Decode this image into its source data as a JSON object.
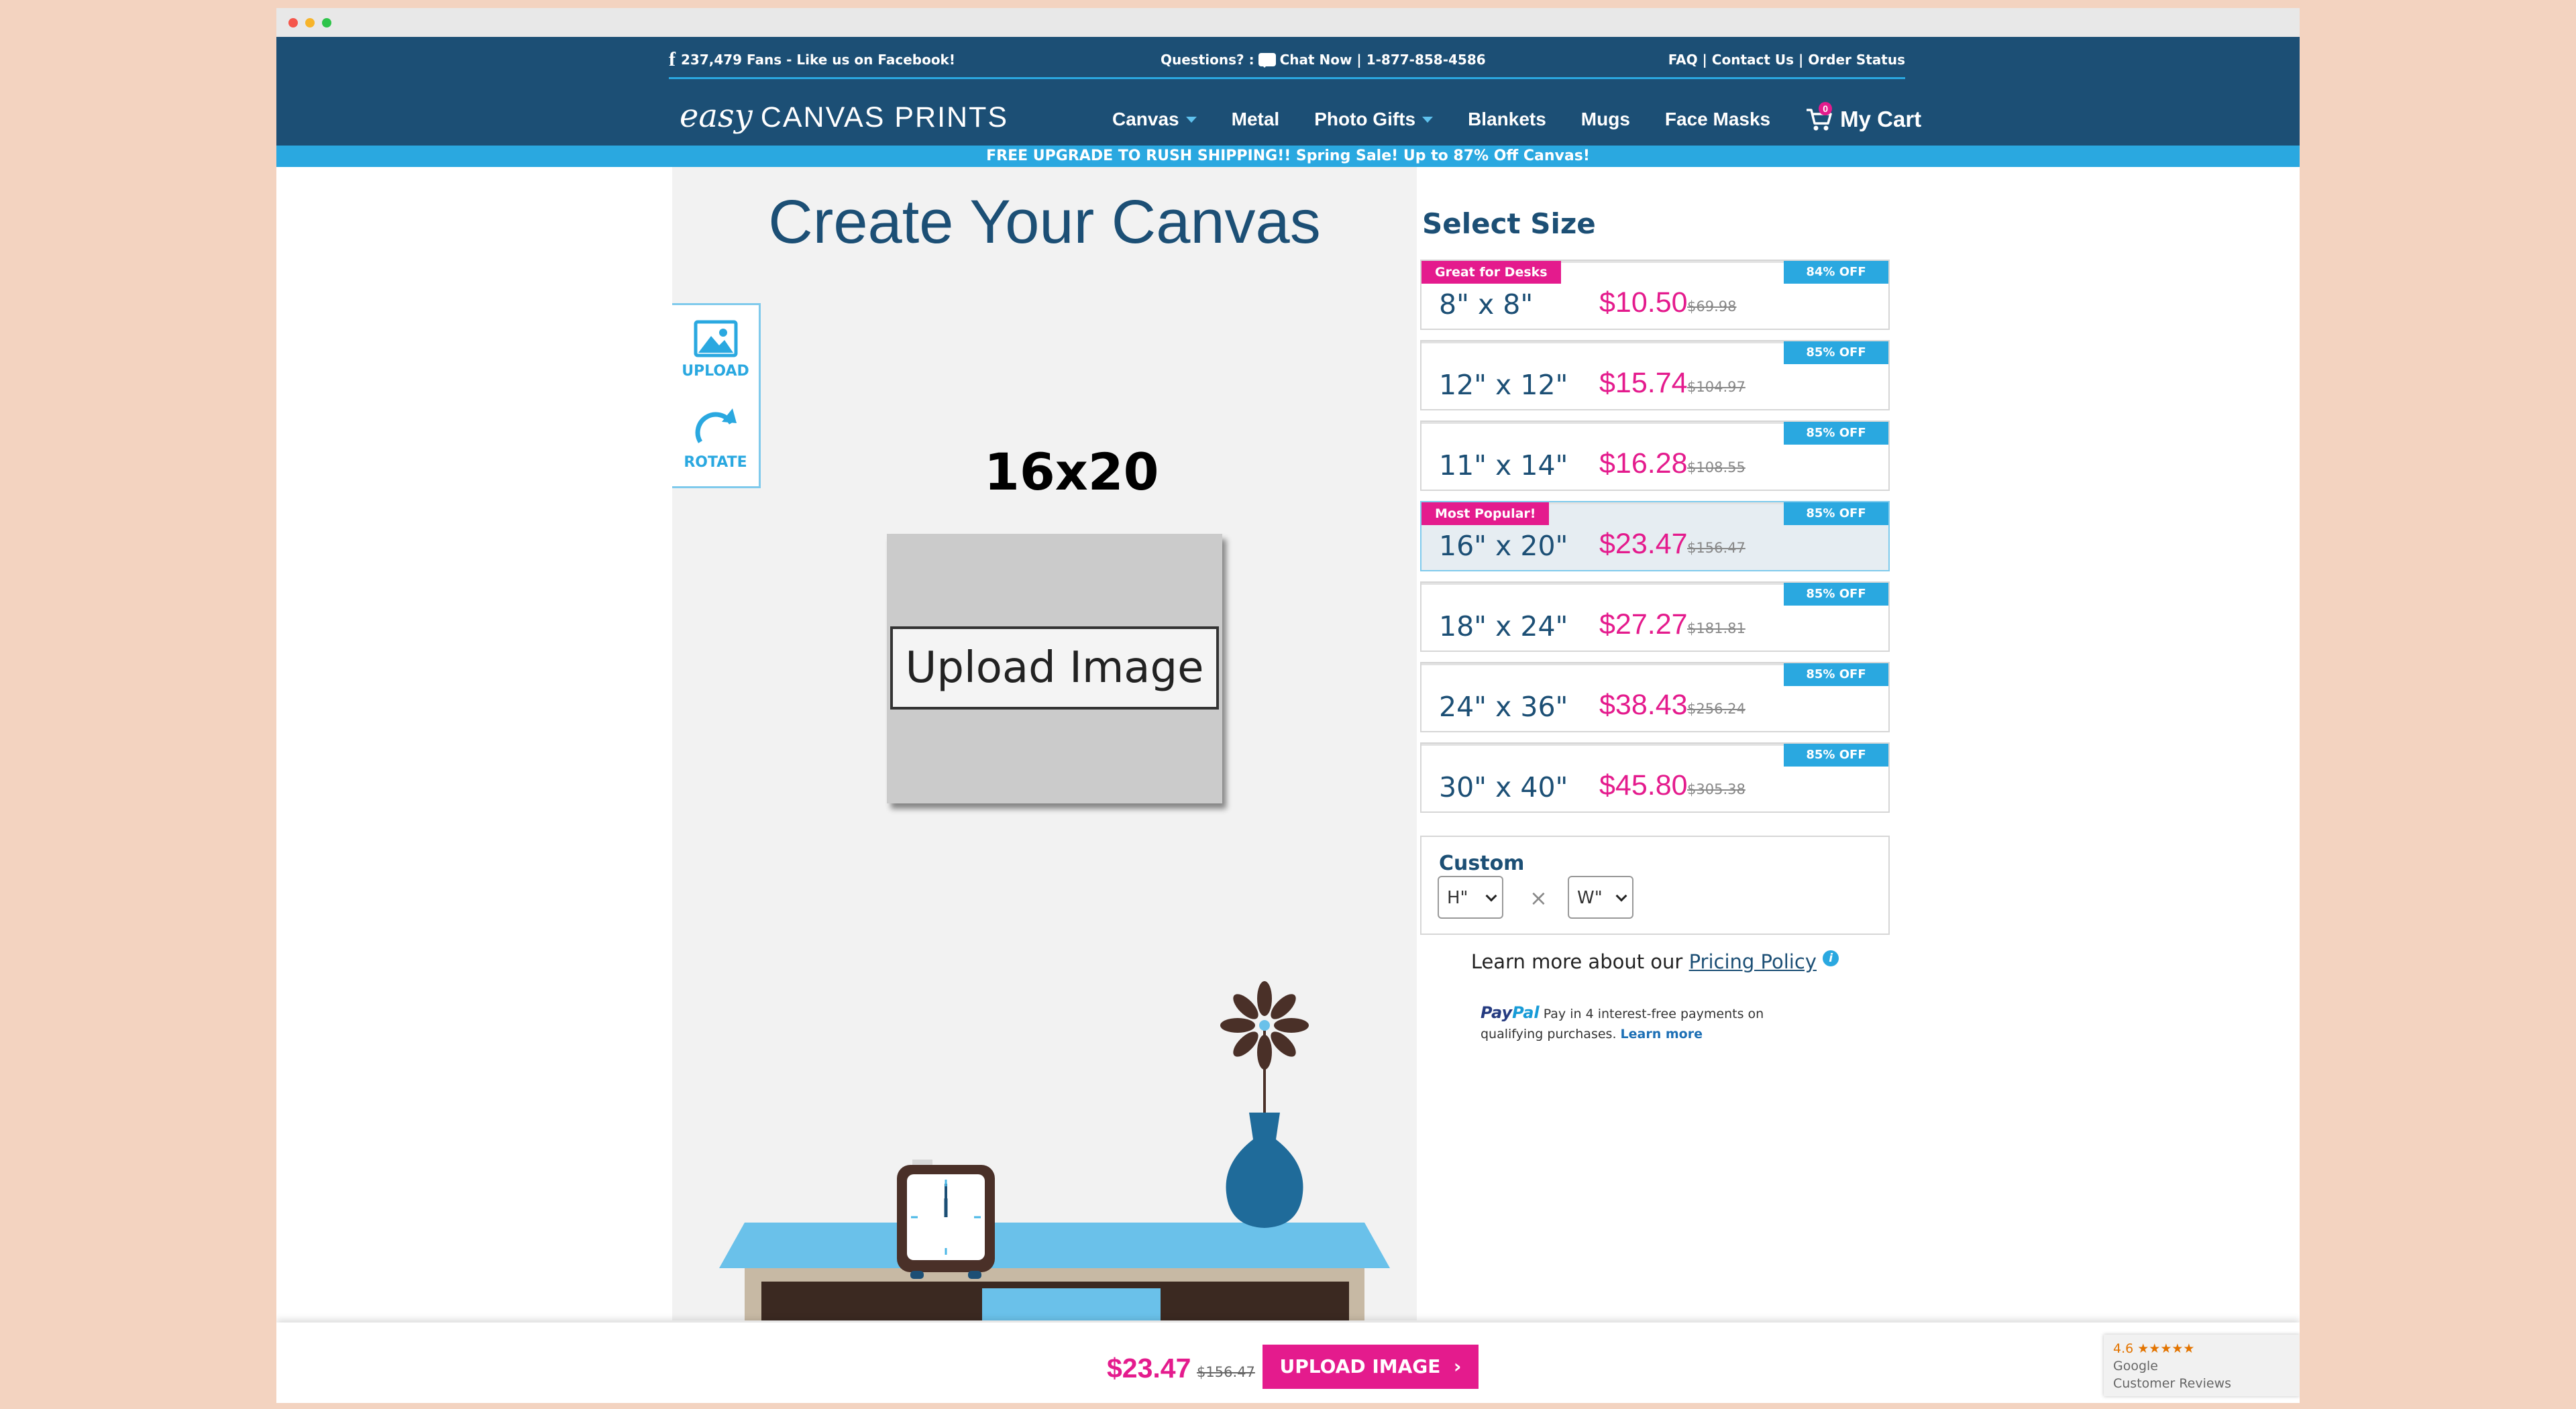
{
  "topbar": {
    "fans": "237,479 Fans - Like us on Facebook!",
    "questions": "Questions? :",
    "chat": "Chat Now | 1-877-858-4586",
    "links": "FAQ | Contact Us | Order Status"
  },
  "logo": {
    "easy": "easy",
    "brand": "CANVAS PRINTS"
  },
  "nav": {
    "items": [
      {
        "label": "Canvas",
        "dropdown": true
      },
      {
        "label": "Metal",
        "dropdown": false
      },
      {
        "label": "Photo Gifts",
        "dropdown": true
      },
      {
        "label": "Blankets",
        "dropdown": false
      },
      {
        "label": "Mugs",
        "dropdown": false
      },
      {
        "label": "Face Masks",
        "dropdown": false
      }
    ],
    "cart_label": "My Cart",
    "cart_count": "0"
  },
  "promo": "FREE UPGRADE TO RUSH SHIPPING!! Spring Sale! Up to 87% Off Canvas!",
  "editor": {
    "title": "Create Your Canvas",
    "upload_tool": "UPLOAD",
    "rotate_tool": "ROTATE",
    "size_label": "16x20",
    "upload_button": "Upload Image"
  },
  "sizes": {
    "title": "Select Size",
    "options": [
      {
        "dim": "8\" x 8\"",
        "price": "$10.50",
        "old": "$69.98",
        "off": "84% OFF",
        "tag": "Great for Desks"
      },
      {
        "dim": "12\" x 12\"",
        "price": "$15.74",
        "old": "$104.97",
        "off": "85% OFF",
        "tag": ""
      },
      {
        "dim": "11\" x 14\"",
        "price": "$16.28",
        "old": "$108.55",
        "off": "85% OFF",
        "tag": ""
      },
      {
        "dim": "16\" x 20\"",
        "price": "$23.47",
        "old": "$156.47",
        "off": "85% OFF",
        "tag": "Most Popular!"
      },
      {
        "dim": "18\" x 24\"",
        "price": "$27.27",
        "old": "$181.81",
        "off": "85% OFF",
        "tag": ""
      },
      {
        "dim": "24\" x 36\"",
        "price": "$38.43",
        "old": "$256.24",
        "off": "85% OFF",
        "tag": ""
      },
      {
        "dim": "30\" x 40\"",
        "price": "$45.80",
        "old": "$305.38",
        "off": "85% OFF",
        "tag": ""
      }
    ],
    "selected_index": 3,
    "custom": {
      "label": "Custom",
      "height": "H\"",
      "width": "W\"",
      "times": "×"
    },
    "learn_text": "Learn more about our",
    "learn_link": "Pricing Policy",
    "paypal_brand_1": "Pay",
    "paypal_brand_2": "Pal",
    "paypal_text": "Pay in 4 interest-free payments on qualifying purchases.",
    "paypal_link": "Learn more"
  },
  "bottom": {
    "price": "$23.47",
    "old": "$156.47",
    "button": "UPLOAD IMAGE"
  },
  "reviews": {
    "rating": "4.6 ★★★★★",
    "source": "Google",
    "label": "Customer Reviews"
  },
  "colors": {
    "navy": "#1c4f75",
    "accent_blue": "#2aa8e0",
    "magenta": "#e41b8d",
    "page_bg": "#f3d3c0"
  }
}
